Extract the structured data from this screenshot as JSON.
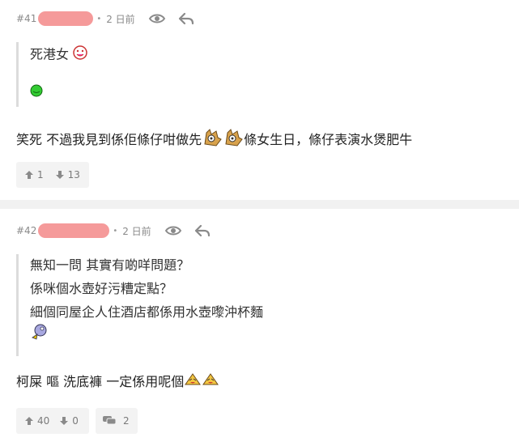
{
  "posts": [
    {
      "number": "#41",
      "time": "2 日前",
      "quote_lines": [
        "死港女"
      ],
      "body": "笑死 不過我見到係佢條仔咁做先",
      "body_after": "條女生日，條仔表演水煲肥牛",
      "upvotes": "1",
      "downvotes": "13"
    },
    {
      "number": "#42",
      "time": "2 日前",
      "quote_lines": [
        "無知一問 其實有啲咩問題？",
        "係咪個水壺好污糟定點？",
        "細個同屋企人住酒店都係用水壺嚟沖杯麵"
      ],
      "body": "柯屎 嘔 洗底褲 一定係用呢個",
      "upvotes": "40",
      "downvotes": "0",
      "replies": "2"
    }
  ],
  "icons": {
    "view": "eye-icon",
    "reply": "reply-arrow-icon",
    "up": "thumb-up-arrow-icon",
    "down": "thumb-down-arrow-icon",
    "comment": "comment-bubble-icon"
  },
  "colors": {
    "redacted_name": "#f59a9a",
    "meta_text": "#8a8a8a",
    "divider": "#f1f1f1",
    "button_bg": "#f3f3f3"
  }
}
